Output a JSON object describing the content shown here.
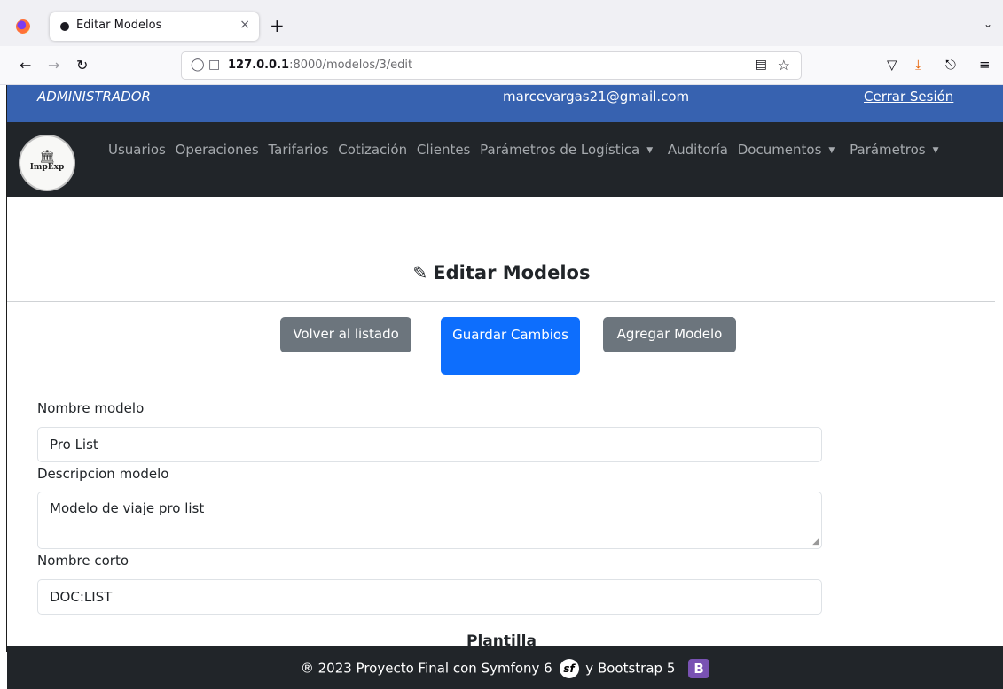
{
  "browser": {
    "tab_title": "Editar Modelos",
    "tab_close": "×",
    "new_tab": "+",
    "url_host": "127.0.0.1",
    "url_rest": ":8000/modelos/3/edit"
  },
  "header": {
    "role": "ADMINISTRADOR",
    "email": "marcevargas21@gmail.com",
    "logout": "Cerrar Sesión"
  },
  "logo": {
    "text": "ImpExp"
  },
  "nav": {
    "items": [
      "Usuarios",
      "Operaciones",
      "Tarifarios",
      "Cotización",
      "Clientes",
      "Parámetros de Logística",
      "Auditoría",
      "Documentos",
      "Parámetros"
    ]
  },
  "page": {
    "title": "Editar Modelos",
    "btn_back": "Volver al listado",
    "btn_save": "Guardar Cambios",
    "btn_add": "Agregar Modelo"
  },
  "form": {
    "name_label": "Nombre modelo",
    "name_value": "Pro List",
    "desc_label": "Descripcion modelo",
    "desc_value": "Modelo de viaje pro list",
    "short_label": "Nombre corto",
    "short_value": "DOC:LIST",
    "section_title": "Plantilla"
  },
  "footer": {
    "text_before": "® 2023 Proyecto Final con Symfony 6",
    "text_after": "y Bootstrap 5"
  },
  "colors": {
    "header_blue": "#3762b0",
    "navbar_dark": "#212529",
    "primary": "#0d6efd",
    "secondary": "#6c757d"
  }
}
